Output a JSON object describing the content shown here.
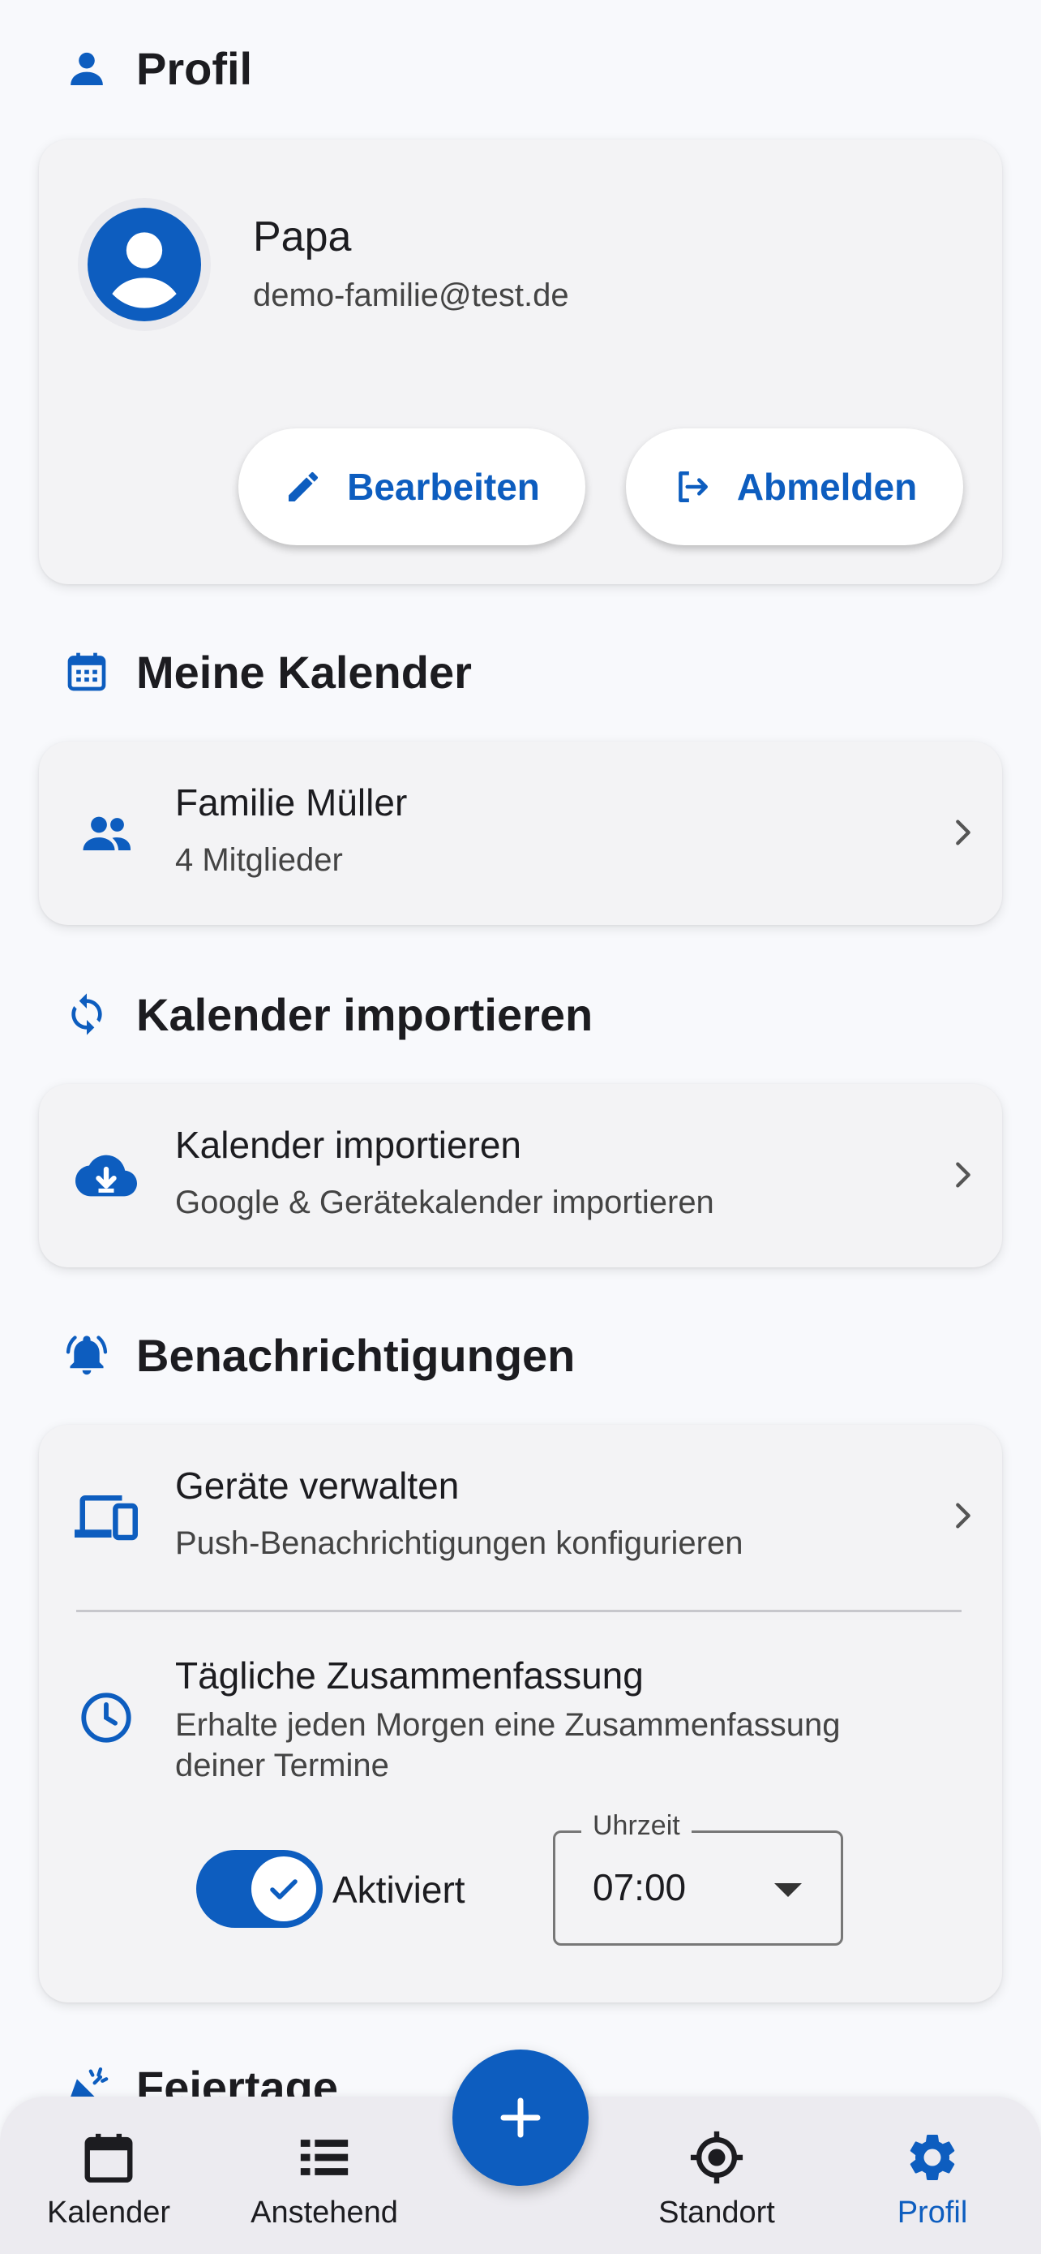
{
  "colors": {
    "accent": "#0d5dbf",
    "background": "#f8f9fc",
    "card": "#f3f3f5"
  },
  "profile_section": {
    "title": "Profil",
    "icon": "person-icon",
    "name": "Papa",
    "email": "demo-familie@test.de",
    "edit_label": "Bearbeiten",
    "logout_label": "Abmelden"
  },
  "calendars_section": {
    "title": "Meine Kalender",
    "icon": "calendar-icon",
    "items": [
      {
        "title": "Familie Müller",
        "subtitle": "4 Mitglieder",
        "icon": "group-icon"
      }
    ]
  },
  "import_section": {
    "title": "Kalender importieren",
    "icon": "sync-icon",
    "items": [
      {
        "title": "Kalender importieren",
        "subtitle": "Google & Gerätekalender importieren",
        "icon": "cloud-download-icon"
      }
    ]
  },
  "notifications_section": {
    "title": "Benachrichtigungen",
    "icon": "bell-icon",
    "devices": {
      "title": "Geräte verwalten",
      "subtitle": "Push-Benachrichtigungen konfigurieren",
      "icon": "devices-icon"
    },
    "daily_summary": {
      "title": "Tägliche Zusammenfassung",
      "subtitle_line1": "Erhalte jeden Morgen eine Zusammenfassung",
      "subtitle_line2": "deiner Termine",
      "icon": "clock-icon",
      "toggle_label": "Aktiviert",
      "toggle_on": true,
      "time_label": "Uhrzeit",
      "time_value": "07:00"
    }
  },
  "holidays_section": {
    "title": "Feiertage",
    "icon": "celebration-icon"
  },
  "fab": {
    "icon": "plus-icon"
  },
  "bottom_nav": {
    "items": [
      {
        "label": "Kalender",
        "icon": "calendar-icon",
        "active": false
      },
      {
        "label": "Anstehend",
        "icon": "list-icon",
        "active": false
      },
      {
        "label": "Standort",
        "icon": "location-target-icon",
        "active": false
      },
      {
        "label": "Profil",
        "icon": "gear-icon",
        "active": true
      }
    ]
  }
}
